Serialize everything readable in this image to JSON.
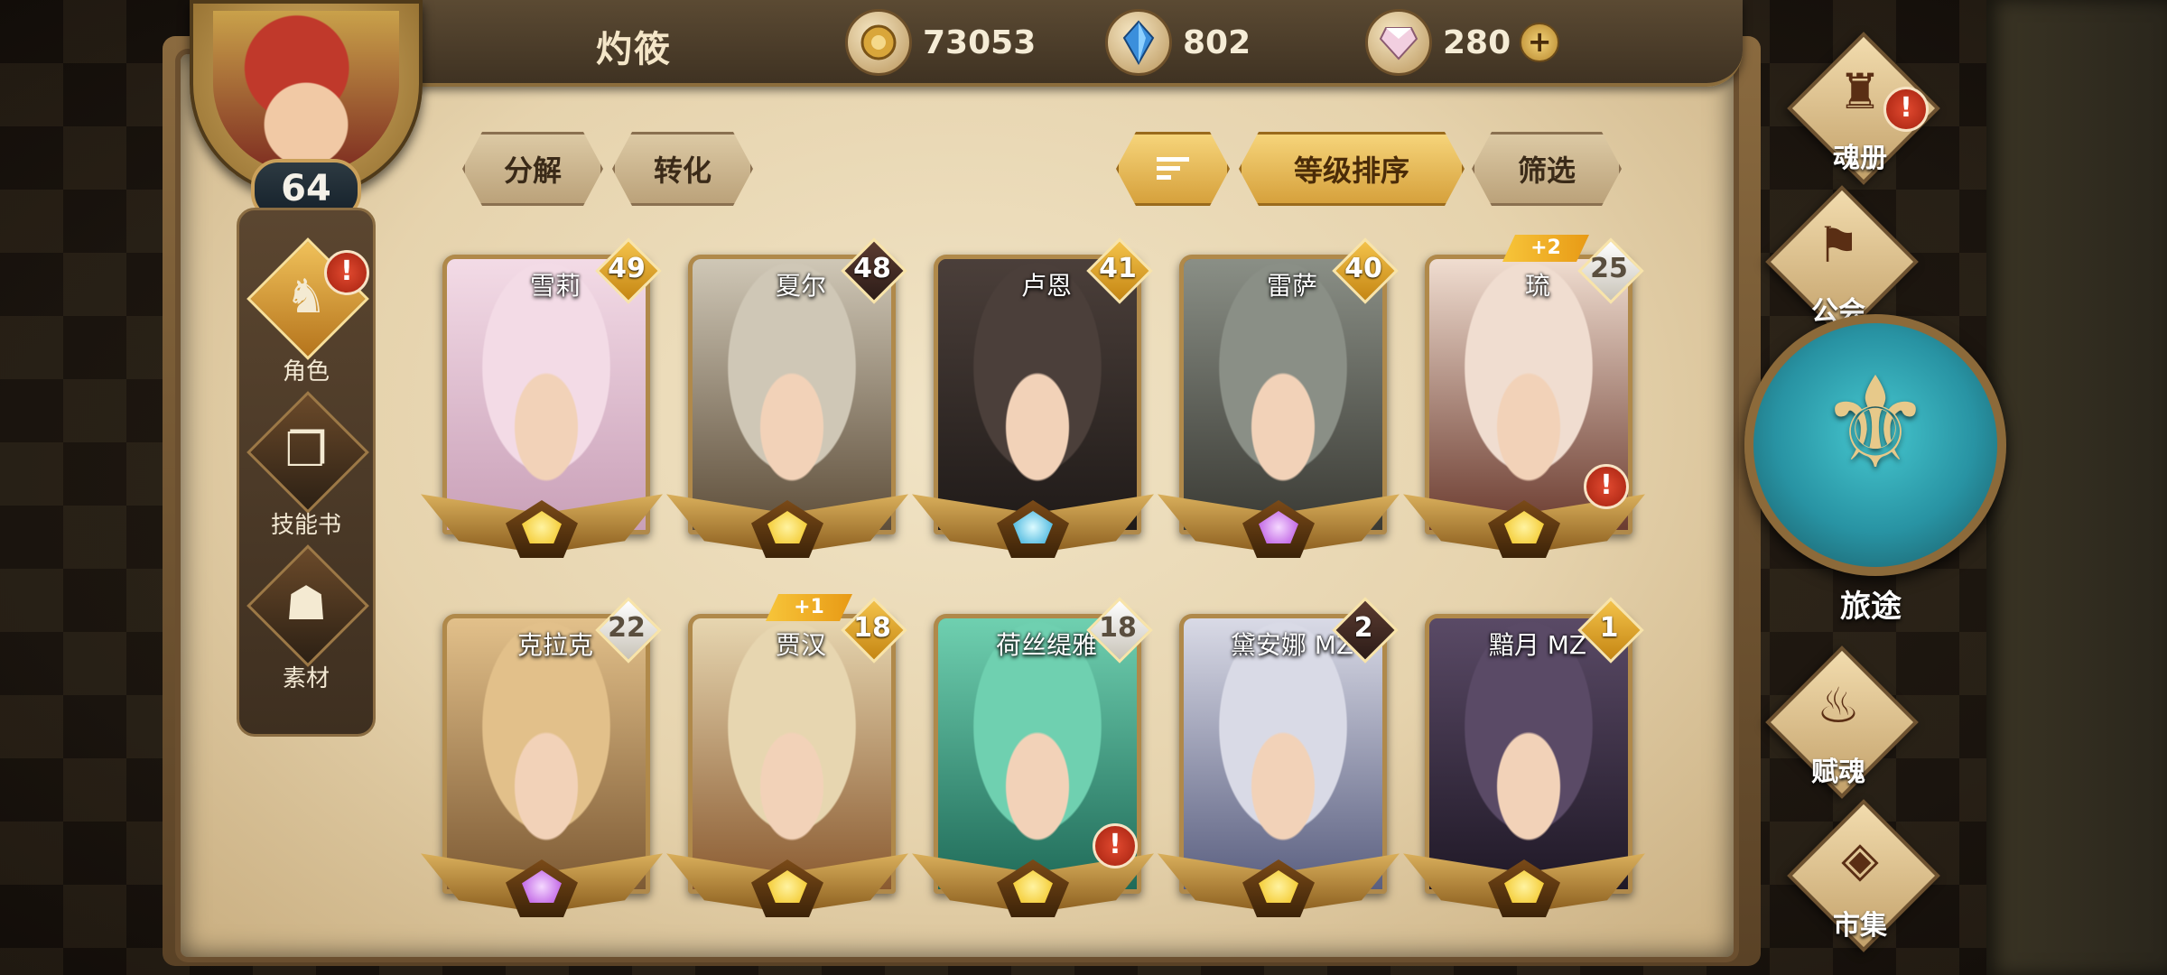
{
  "player": {
    "name": "灼筱",
    "level": "64"
  },
  "currencies": [
    {
      "icon": "gold-coin-icon",
      "value": "73053"
    },
    {
      "icon": "blue-crystal-icon",
      "value": "802"
    },
    {
      "icon": "pink-gem-icon",
      "value": "280"
    }
  ],
  "left_nav": [
    {
      "label": "角色",
      "icon": "character-icon",
      "active": true,
      "alert": "!"
    },
    {
      "label": "技能书",
      "icon": "skill-book-icon",
      "active": false
    },
    {
      "label": "素材",
      "icon": "material-icon",
      "active": false
    }
  ],
  "toolbar": {
    "decompose": "分解",
    "convert": "转化",
    "sort_by_level": "等级排序",
    "filter": "筛选"
  },
  "cards": [
    {
      "name": "雪莉",
      "level": "49",
      "badge": "gold",
      "gem": "gold",
      "colors": [
        "#f3dbe6",
        "#c9a0b8"
      ]
    },
    {
      "name": "夏尔",
      "level": "48",
      "badge": "dark",
      "gem": "gold",
      "colors": [
        "#cfc7b6",
        "#5e4e3a"
      ]
    },
    {
      "name": "卢恩",
      "level": "41",
      "badge": "gold",
      "gem": "blue",
      "colors": [
        "#4b3f3a",
        "#1f1a18"
      ]
    },
    {
      "name": "雷萨",
      "level": "40",
      "badge": "gold",
      "gem": "purple",
      "colors": [
        "#8a8f86",
        "#3a3a34"
      ]
    },
    {
      "name": "琉",
      "level": "25",
      "badge": "silver",
      "gem": "gold",
      "plus": "+2",
      "alert": "!",
      "colors": [
        "#f0ddd0",
        "#6b3b2f"
      ]
    },
    {
      "name": "克拉克",
      "level": "22",
      "badge": "silver",
      "gem": "purple",
      "colors": [
        "#e2c08a",
        "#7d5a34"
      ]
    },
    {
      "name": "贾汉",
      "level": "18",
      "badge": "gold",
      "gem": "gold",
      "plus": "+1",
      "colors": [
        "#e7d6b0",
        "#8a5a30"
      ]
    },
    {
      "name": "荷丝缇雅",
      "level": "18",
      "badge": "silver",
      "gem": "gold",
      "alert": "!",
      "colors": [
        "#6fd0b0",
        "#1f6a58"
      ]
    },
    {
      "name": "黛安娜 MZ",
      "level": "2",
      "badge": "dark",
      "gem": "gold",
      "colors": [
        "#d9dae6",
        "#5a5f80"
      ]
    },
    {
      "name": "黯月 MZ",
      "level": "1",
      "badge": "gold",
      "gem": "gold",
      "colors": [
        "#5a4a66",
        "#1f1826"
      ]
    }
  ],
  "right_nav": [
    {
      "label": "魂册",
      "icon": "soul-book-icon",
      "alert": "!"
    },
    {
      "label": "公会",
      "icon": "guild-icon"
    },
    {
      "label": "旅途",
      "icon": "journey-icon"
    },
    {
      "label": "赋魂",
      "icon": "soul-infuse-icon"
    },
    {
      "label": "市集",
      "icon": "market-icon"
    }
  ],
  "colors": {
    "accent_gold": "#f3c24a",
    "parchment": "#e6d3ad",
    "alert_red": "#e24a30"
  }
}
